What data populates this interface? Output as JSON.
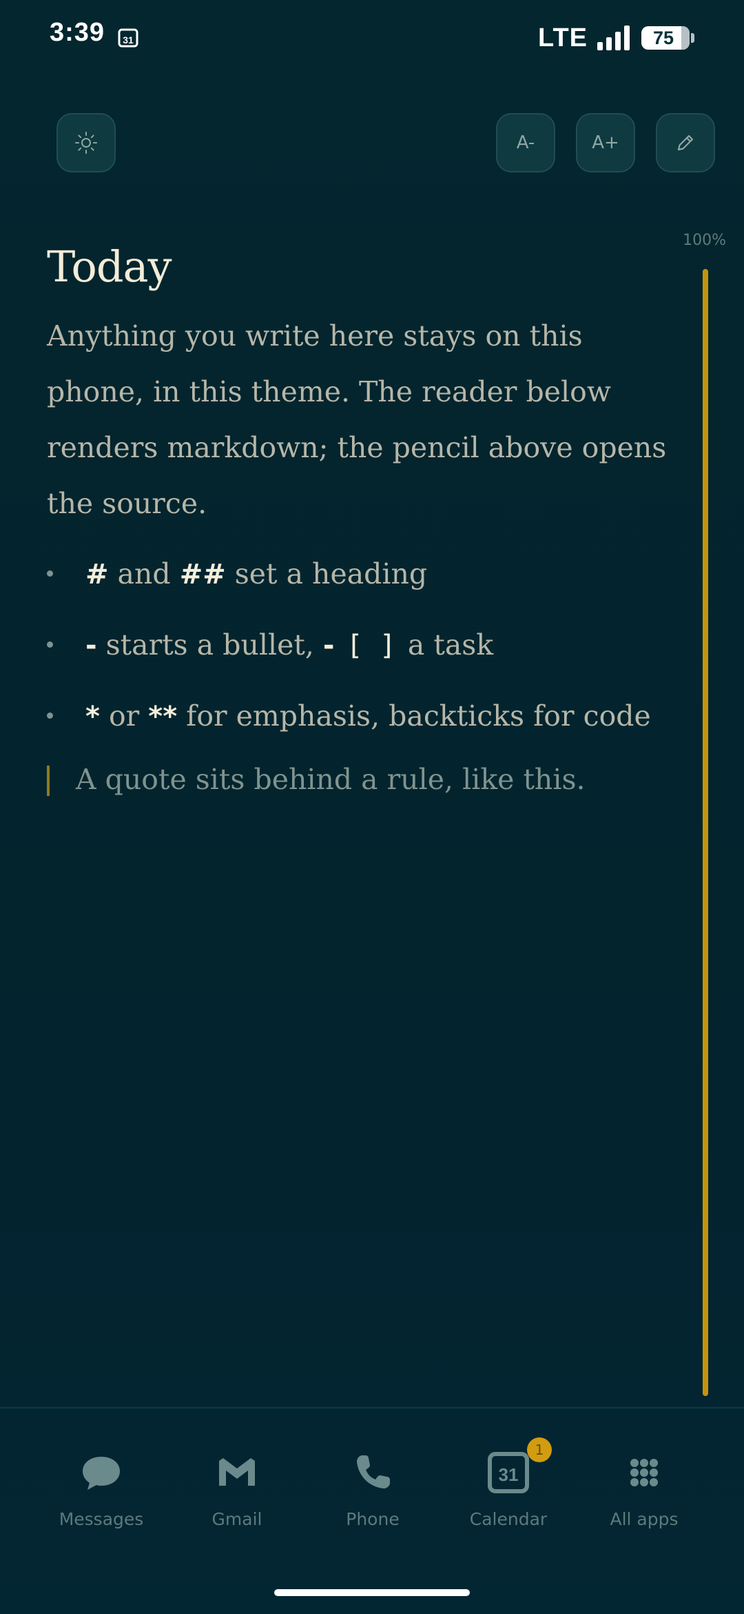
{
  "status_bar": {
    "time": "3:39",
    "calendar_day": "31",
    "network": "LTE",
    "battery": "75"
  },
  "toolbar": {
    "font_decrease_label": "A-",
    "font_increase_label": "A+"
  },
  "reader": {
    "progress_label": "100%",
    "progress": 1.0,
    "accent_color": "#c4940e",
    "title": "Today",
    "paragraph": "Anything you write here stays on this phone, in this theme. The reader below renders markdown; the pencil above opens the source.",
    "list": [
      {
        "parts": [
          "#",
          " and ",
          "##",
          " set a heading"
        ]
      },
      {
        "parts": [
          "-",
          " starts a bullet, ",
          "-",
          "[ ]",
          " a task"
        ]
      },
      {
        "parts": [
          "*",
          " or ",
          "**",
          " for emphasis, backticks for code"
        ]
      }
    ],
    "quote": "A quote sits behind a rule, like this."
  },
  "dock": {
    "items": [
      {
        "label": "Messages",
        "icon": "messages-icon"
      },
      {
        "label": "Gmail",
        "icon": "gmail-icon"
      },
      {
        "label": "Phone",
        "icon": "phone-icon"
      },
      {
        "label": "Calendar",
        "icon": "calendar-icon",
        "calendar_day": "31",
        "badge": "1"
      },
      {
        "label": "All apps",
        "icon": "all-apps-icon"
      }
    ]
  }
}
